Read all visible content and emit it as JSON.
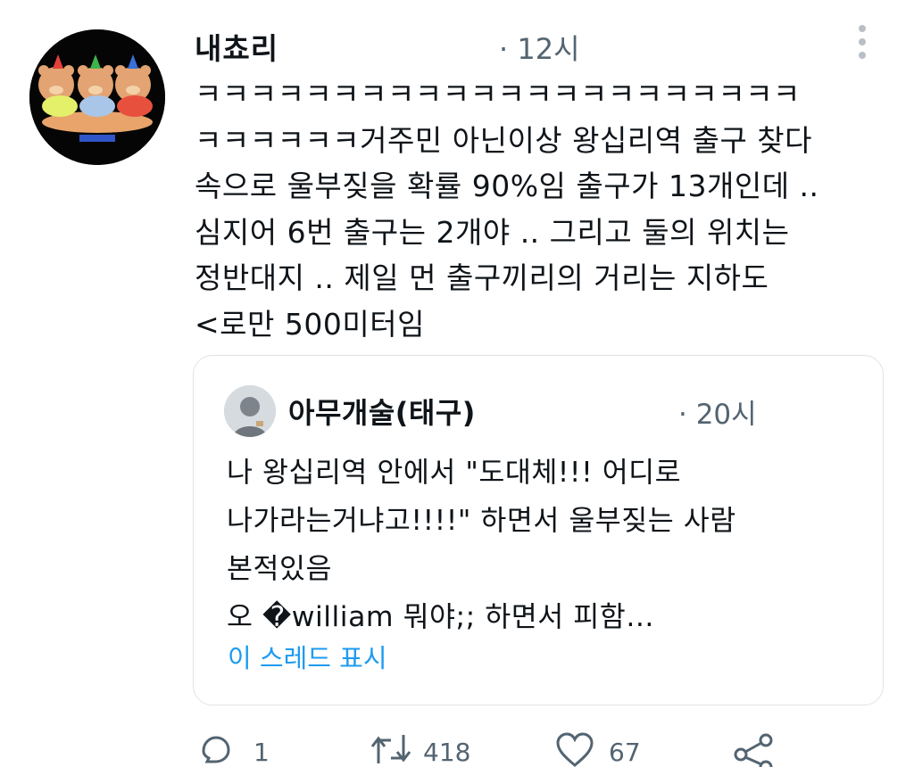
{
  "tweet": {
    "username": "내쵸리",
    "timestamp": "· 12시",
    "lines": [
      "ㅋㅋㅋㅋㅋㅋㅋㅋㅋㅋㅋㅋㅋㅋㅋㅋㅋㅋㅋㅋㅋㅋ",
      "ㅋㅋㅋㅋㅋㅋ거주민 아닌이상 왕십리역 출구 찾다",
      "속으로 울부짖을 확률 90%임 출구가 13개인데 ..",
      "심지어 6번 출구는 2개야 .. 그리고 둘의 위치는",
      "정반대지 .. 제일 먼 출구끼리의 거리는 지하도",
      "<로만 500미터임"
    ]
  },
  "quote": {
    "username": "아무개술(태구)",
    "timestamp": "· 20시",
    "lines": [
      "나 왕십리역 안에서 \"도대체!!! 어디로",
      "나가라는거냐고!!!!\" 하면서 울부짖는 사람",
      "본적있음",
      "오 �william 뭐야;; 하면서 피함…"
    ],
    "show_thread": "이 스레드 표시"
  },
  "actions": {
    "reply_count": "1",
    "retweet_count": "418",
    "like_count": "67"
  },
  "colors": {
    "link": "#1d9bf0",
    "muted": "#536471",
    "border": "#dfe3e7"
  }
}
